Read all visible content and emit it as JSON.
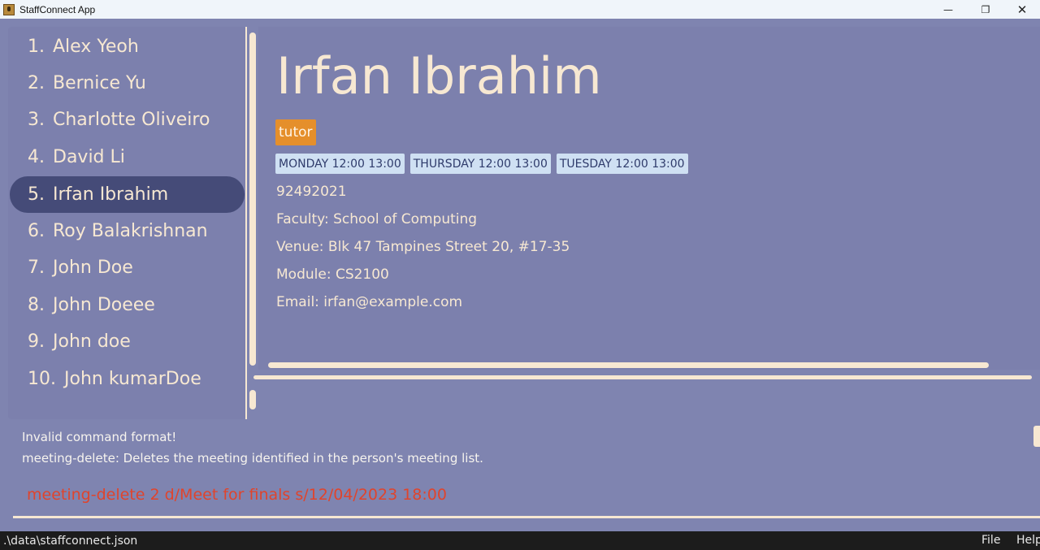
{
  "window": {
    "title": "StaffConnect App",
    "controls": {
      "minimize": "—",
      "restore": "❐",
      "close": "✕"
    }
  },
  "person_list": [
    {
      "index": "1.",
      "name": "Alex Yeoh"
    },
    {
      "index": "2.",
      "name": "Bernice Yu"
    },
    {
      "index": "3.",
      "name": "Charlotte Oliveiro"
    },
    {
      "index": "4.",
      "name": "David Li"
    },
    {
      "index": "5.",
      "name": "Irfan Ibrahim"
    },
    {
      "index": "6.",
      "name": "Roy Balakrishnan"
    },
    {
      "index": "7.",
      "name": "John Doe"
    },
    {
      "index": "8.",
      "name": "John Doeee"
    },
    {
      "index": "9.",
      "name": "John doe"
    },
    {
      "index": "10.",
      "name": "John kumarDoe"
    }
  ],
  "selected_index": 4,
  "detail": {
    "name": "Irfan Ibrahim",
    "tag": "tutor",
    "meetings": [
      "MONDAY 12:00 13:00",
      "THURSDAY 12:00 13:00",
      "TUESDAY 12:00 13:00"
    ],
    "phone": "92492021",
    "faculty": "Faculty:  School of Computing",
    "venue": "Venue:  Blk 47 Tampines Street 20, #17-35",
    "module": "Module:  CS2100",
    "email": "Email:  irfan@example.com"
  },
  "result": {
    "line1": "Invalid command format!",
    "line2": "meeting-delete: Deletes the meeting identified in the person's meeting list."
  },
  "command": "meeting-delete 2 d/Meet for finals s/12/04/2023 18:00",
  "status": {
    "path": ".\\data\\staffconnect.json",
    "menu_file": "File",
    "menu_help": "Help"
  },
  "colors": {
    "background": "#7f84b0",
    "panel": "#7c80ad",
    "selected": "#454b78",
    "text": "#f7e8d2",
    "tag": "#e58f2b",
    "meeting": "#cfe0f3",
    "command": "#e0442c"
  }
}
